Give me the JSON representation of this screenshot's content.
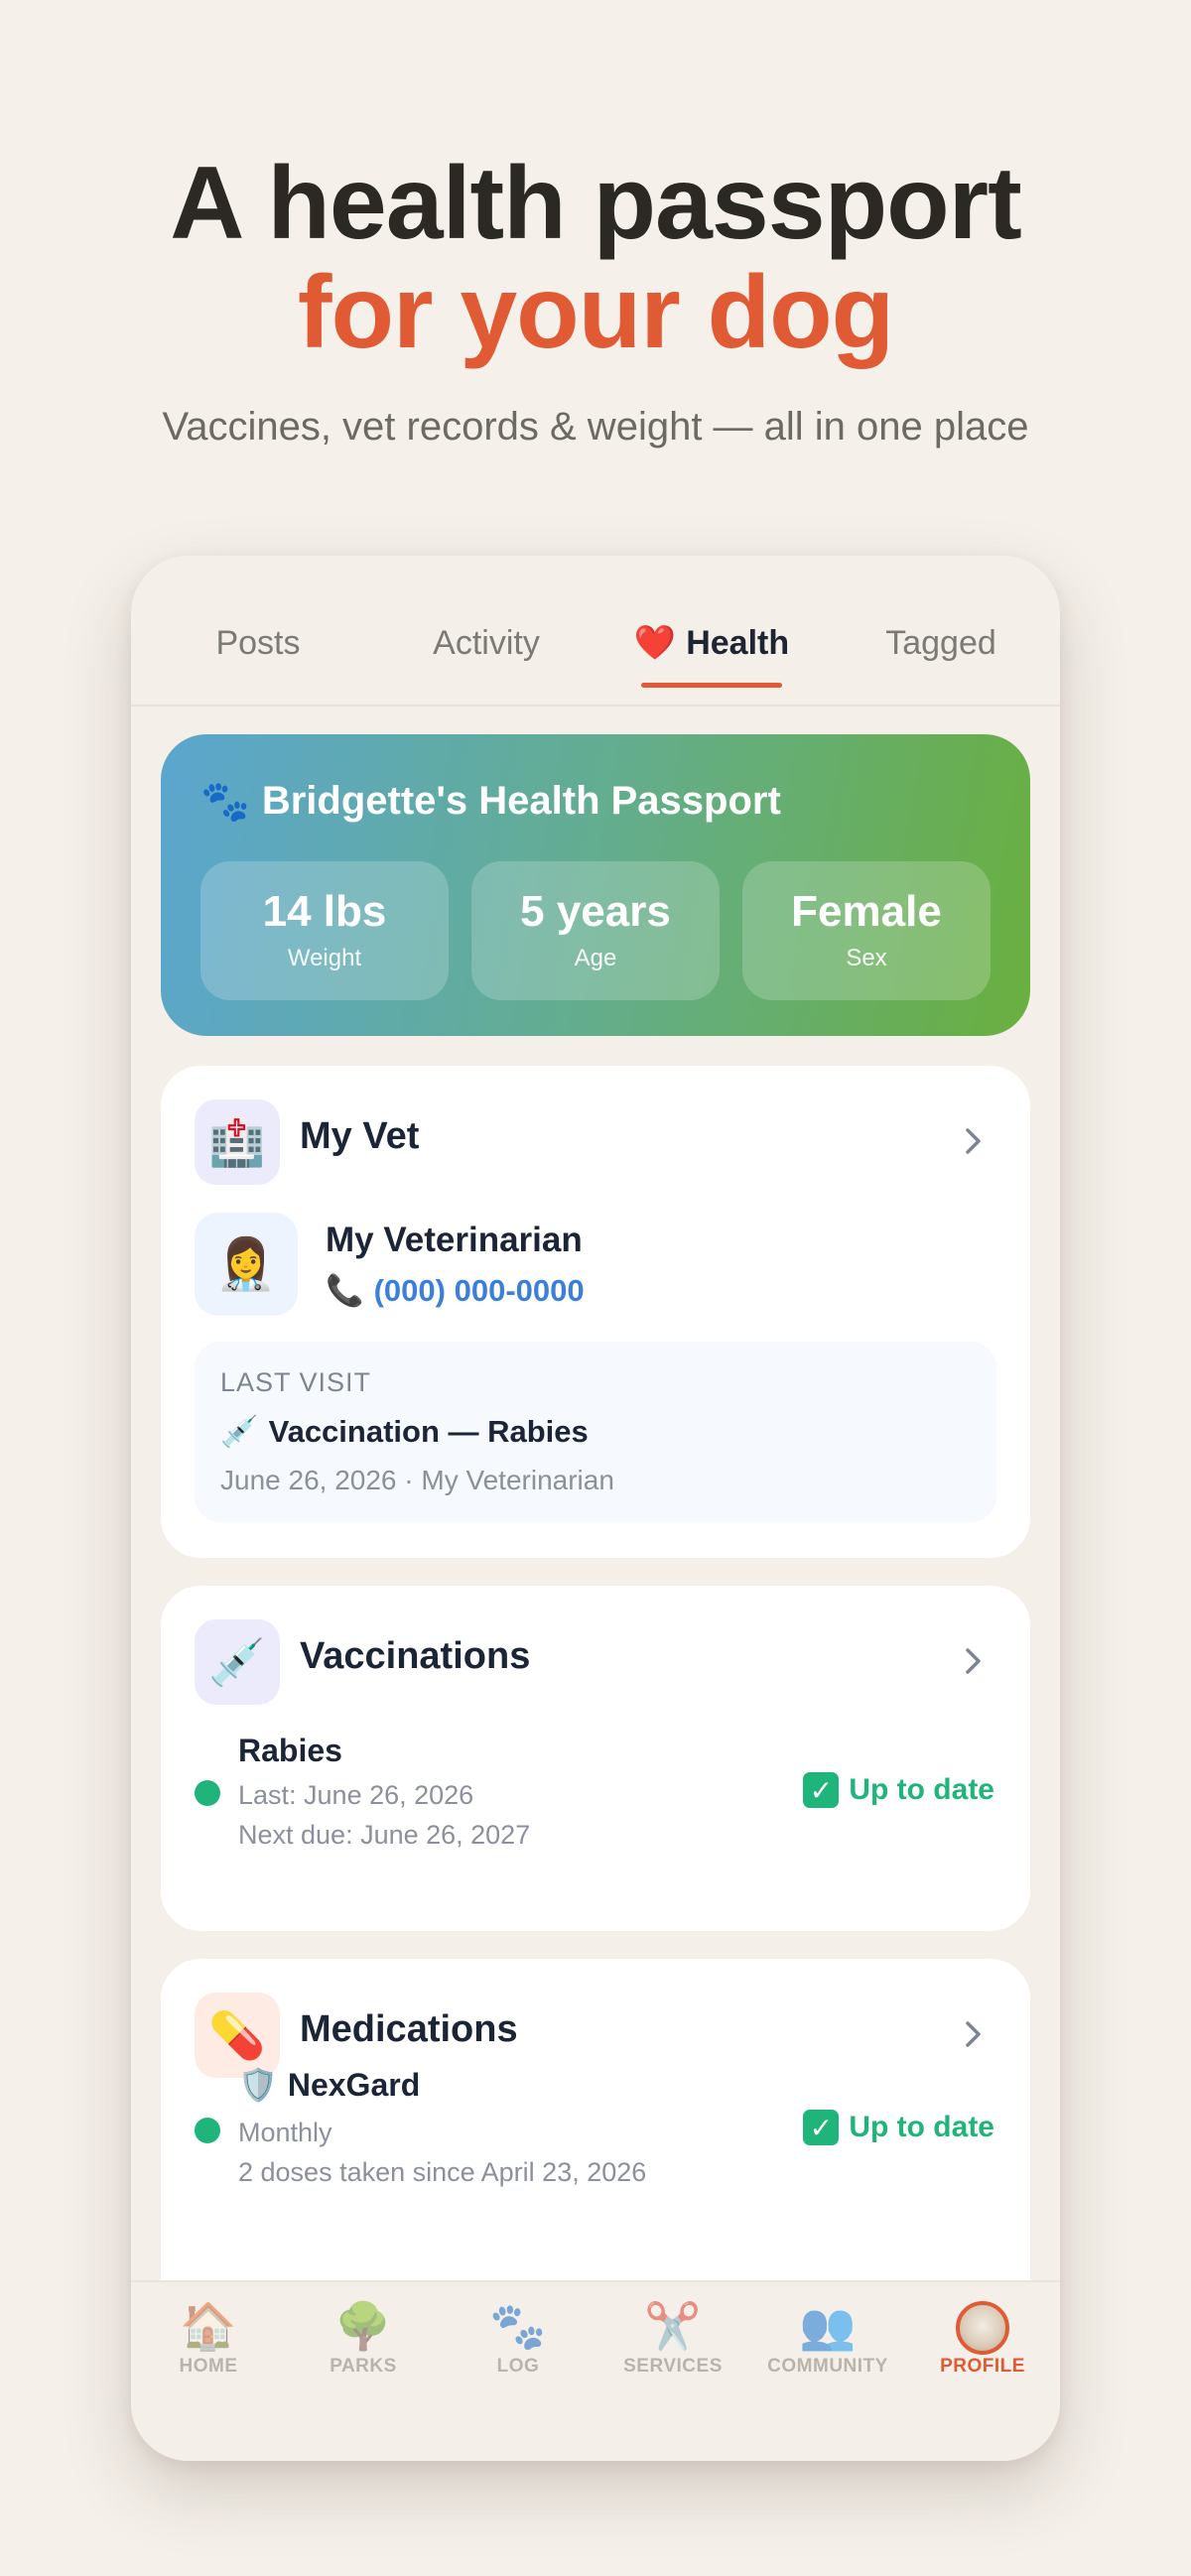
{
  "headline": {
    "line1": "A health passport",
    "line2": "for your dog",
    "subtitle": "Vaccines, vet records & weight — all in one place"
  },
  "tabs": [
    {
      "label": "Posts",
      "icon": "",
      "active": false
    },
    {
      "label": "Activity",
      "icon": "",
      "active": false
    },
    {
      "label": "Health",
      "icon": "❤️",
      "active": true
    },
    {
      "label": "Tagged",
      "icon": "",
      "active": false
    }
  ],
  "passport": {
    "icon": "🐾",
    "title": "Bridgette's Health Passport",
    "stats": [
      {
        "value": "14 lbs",
        "label": "Weight"
      },
      {
        "value": "5 years",
        "label": "Age"
      },
      {
        "value": "Female",
        "label": "Sex"
      }
    ]
  },
  "vet_card": {
    "icon": "🏥",
    "title": "My Vet",
    "avatar": "👩‍⚕️",
    "vet_name": "My Veterinarian",
    "phone_icon": "📞",
    "phone": "(000) 000-0000",
    "last_visit": {
      "label": "LAST VISIT",
      "icon": "💉",
      "title": "Vaccination — Rabies",
      "meta": "June 26, 2026 · My Veterinarian"
    }
  },
  "vaccinations": {
    "icon": "💉",
    "title": "Vaccinations",
    "item": {
      "name": "Rabies",
      "last": "Last: June 26, 2026",
      "next": "Next due: June 26, 2027",
      "status": "Up to date"
    }
  },
  "medications": {
    "icon": "💊",
    "title": "Medications",
    "item": {
      "icon": "🛡️",
      "name": "NexGard",
      "frequency": "Monthly",
      "doses": "2 doses taken since April 23, 2026",
      "status": "Up to date"
    }
  },
  "nav": [
    {
      "label": "HOME",
      "icon": "🏠"
    },
    {
      "label": "PARKS",
      "icon": "🌳"
    },
    {
      "label": "LOG",
      "icon": "🐾"
    },
    {
      "label": "SERVICES",
      "icon": "✂️"
    },
    {
      "label": "COMMUNITY",
      "icon": "👥"
    },
    {
      "label": "PROFILE",
      "icon": "avatar"
    }
  ],
  "colors": {
    "accent": "#e05a34",
    "success": "#1fb57a",
    "link": "#3b7fd9",
    "background": "#f5f0ea"
  }
}
